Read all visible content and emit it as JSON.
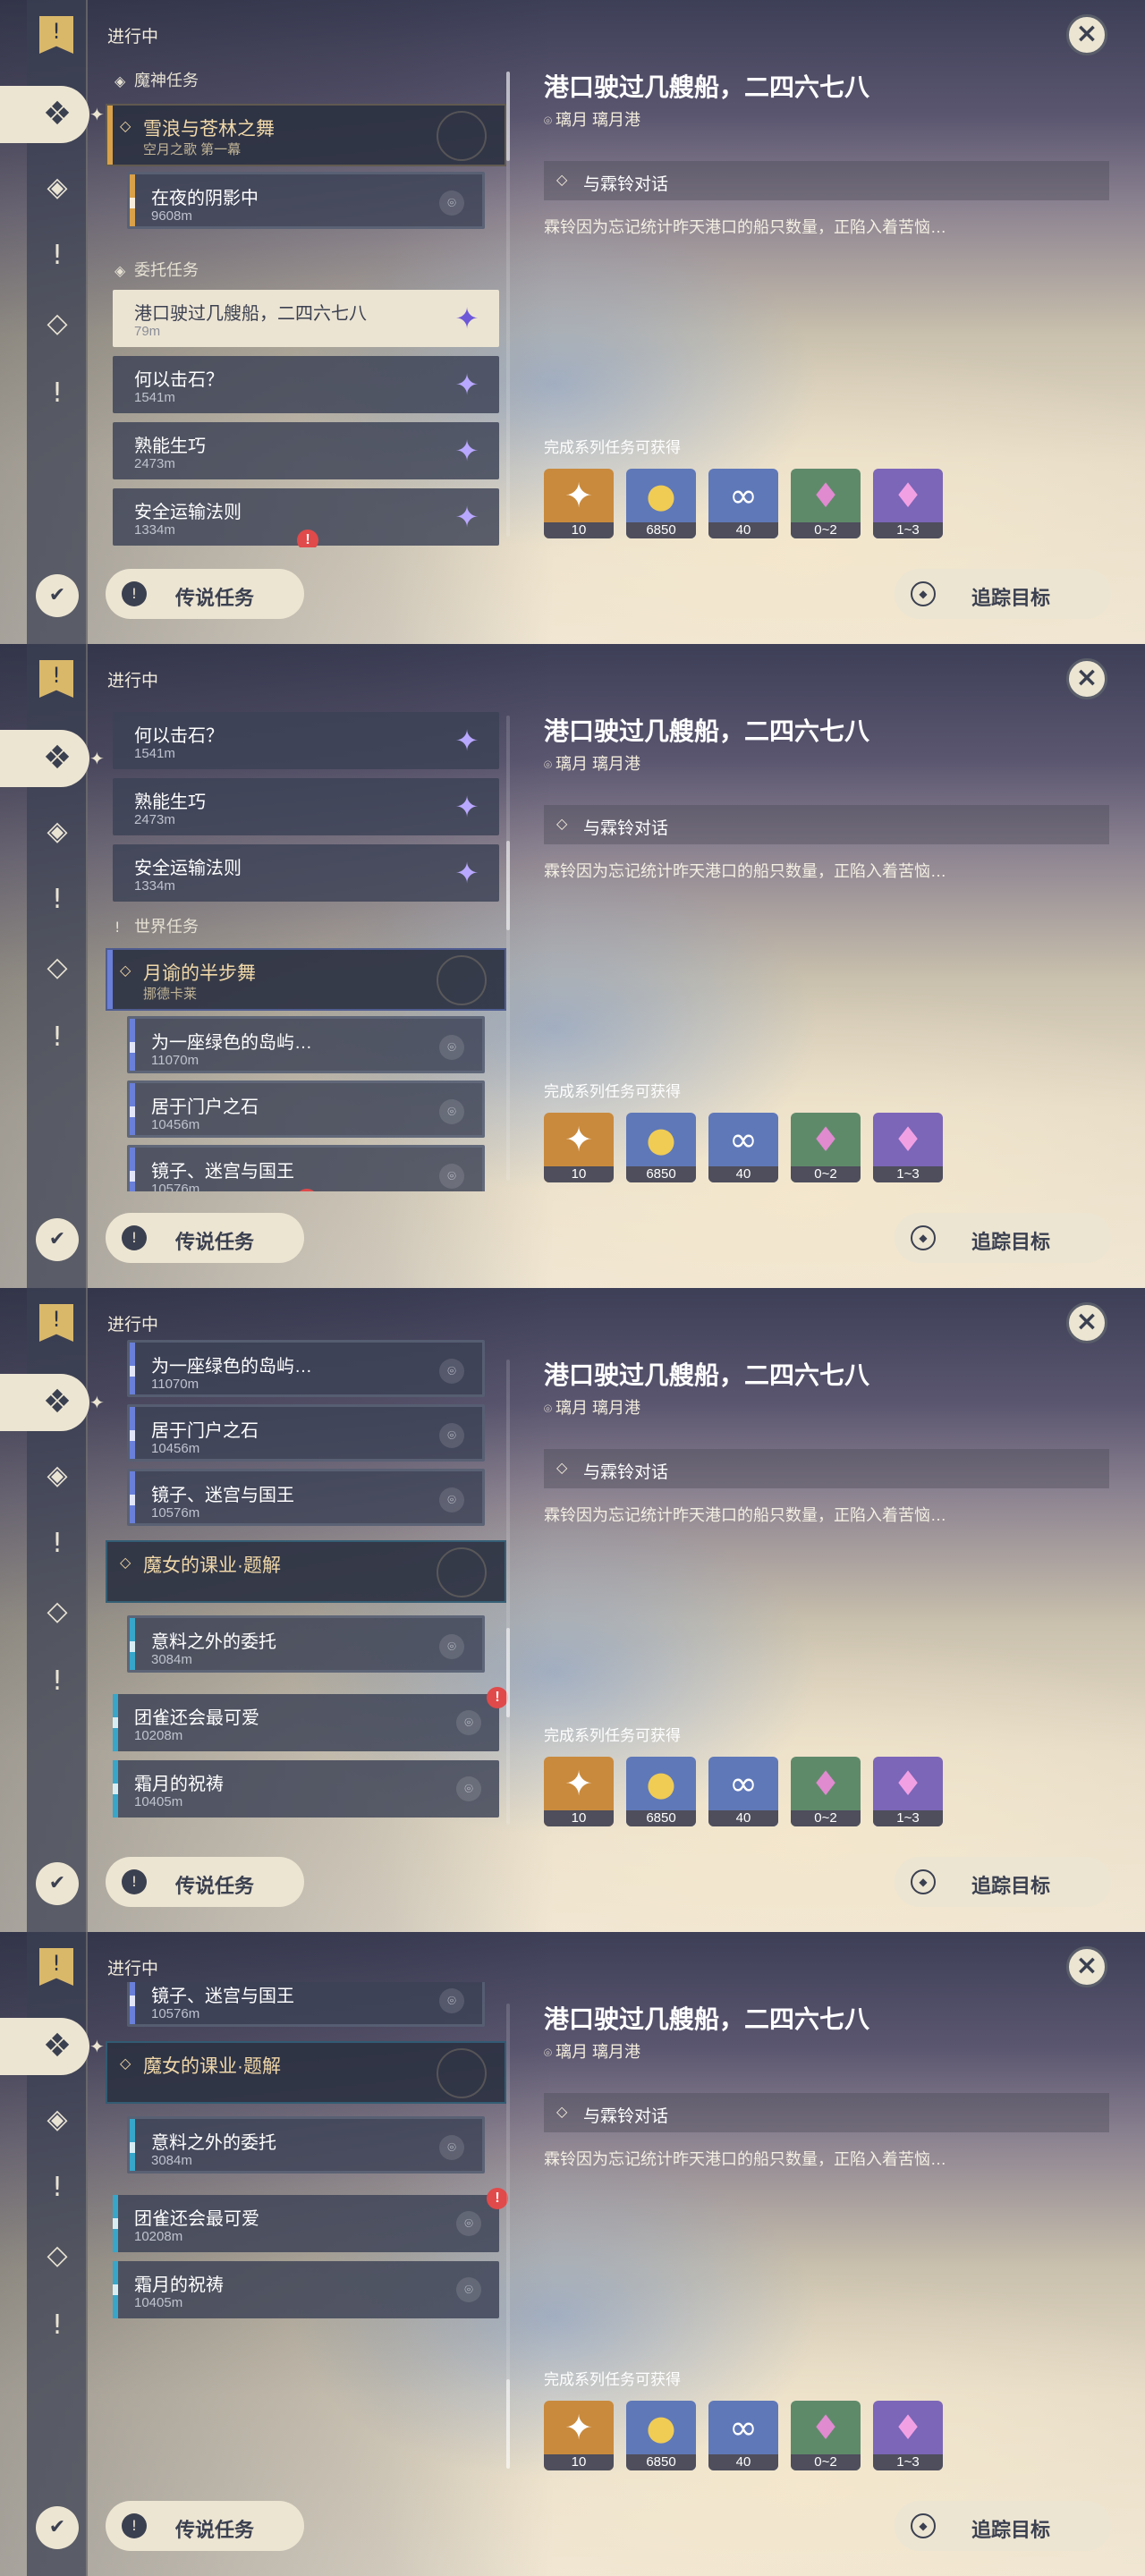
{
  "header": {
    "in_progress": "进行中"
  },
  "categories": {
    "archon": "魔神任务",
    "commission": "委托任务",
    "world": "世界任务"
  },
  "archon_group": {
    "title": "雪浪与苍林之舞",
    "subtitle": "空月之歌 第一幕"
  },
  "world_group_1": {
    "title": "月谕的半步舞",
    "subtitle": "挪德卡莱"
  },
  "world_group_2": {
    "title": "魔女的课业·题解"
  },
  "quests": {
    "night_shadow": {
      "title": "在夜的阴影中",
      "distance": "9608m"
    },
    "harbor": {
      "title": "港口驶过几艘船，二四六七八",
      "distance": "79m"
    },
    "stone": {
      "title": "何以击石？",
      "distance": "1541m"
    },
    "practice": {
      "title": "熟能生巧",
      "distance": "2473m"
    },
    "transport": {
      "title": "安全运输法则",
      "distance": "1334m"
    },
    "island": {
      "title": "为一座绿色的岛屿…",
      "distance": "11070m"
    },
    "doorstone": {
      "title": "居于门户之石",
      "distance": "10456m"
    },
    "mirror": {
      "title": "镜子、迷宫与国王",
      "distance": "10576m"
    },
    "unexpected": {
      "title": "意料之外的委托",
      "distance": "3084m"
    },
    "sparrow": {
      "title": "团雀还会最可爱",
      "distance": "10208m"
    },
    "frostmoon": {
      "title": "霜月的祝祷",
      "distance": "10405m"
    }
  },
  "detail": {
    "title": "港口驶过几艘船，二四六七八",
    "location": "璃月 璃月港",
    "objective": "与霖铃对话",
    "description": "霖铃因为忘记统计昨天港口的船只数量，正陷入着苦恼…",
    "reward_label": "完成系列任务可获得",
    "rewards": [
      {
        "icon": "primogem-icon",
        "qty": "10",
        "color": "#c98a3d"
      },
      {
        "icon": "mora-icon",
        "qty": "6850",
        "color": "#5f78b8"
      },
      {
        "icon": "companionship-exp-icon",
        "qty": "40",
        "color": "#5f78b8"
      },
      {
        "icon": "crystal-chunk-icon",
        "qty": "0~2",
        "color": "#5f8a6a"
      },
      {
        "icon": "crystal-ore-icon",
        "qty": "1~3",
        "color": "#7b66b8"
      }
    ]
  },
  "buttons": {
    "legend": "传说任务",
    "track": "追踪目标"
  },
  "colors": {
    "archon_bar": "#d9a14a",
    "commission_badge": "#b9a8ff",
    "world_bar": "#6a7fd8",
    "witch_bar": "#37a6c9"
  }
}
